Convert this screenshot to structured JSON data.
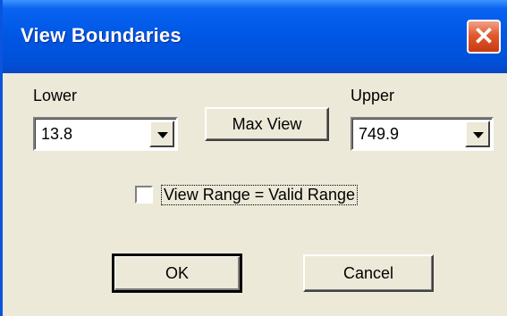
{
  "window": {
    "title": "View Boundaries",
    "close_glyph": "✕"
  },
  "lower": {
    "label": "Lower",
    "value": "13.8"
  },
  "upper": {
    "label": "Upper",
    "value": "749.9"
  },
  "max_view_label": "Max View",
  "checkbox": {
    "label": "View Range = Valid Range",
    "checked": false
  },
  "ok_label": "OK",
  "cancel_label": "Cancel",
  "icons": {
    "dropdown": "chevron-down-icon",
    "close": "close-icon"
  }
}
